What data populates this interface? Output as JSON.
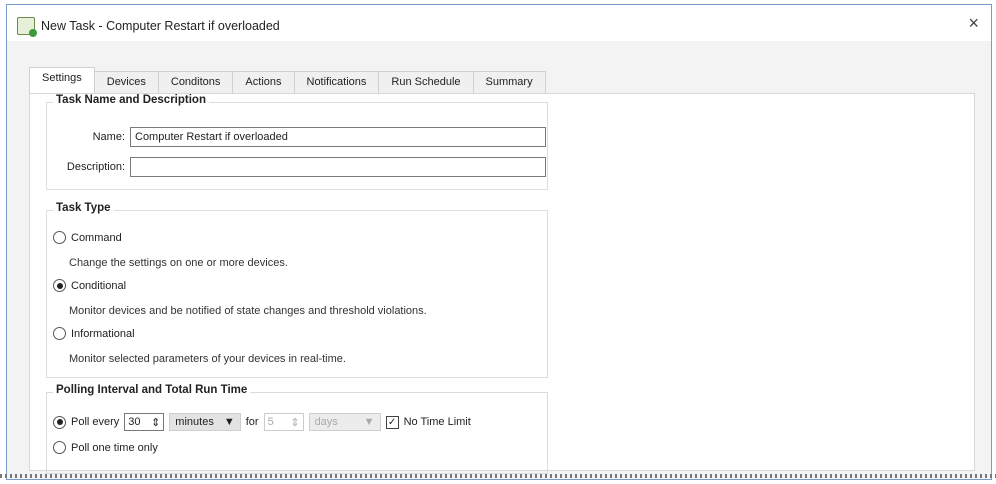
{
  "window": {
    "title": "New Task - Computer Restart if overloaded",
    "close": "×"
  },
  "tabs": [
    "Settings",
    "Devices",
    "Conditons",
    "Actions",
    "Notifications",
    "Run Schedule",
    "Summary"
  ],
  "task_name": {
    "heading": "Task Name and Description",
    "name_label": "Name:",
    "name_value": "Computer Restart if overloaded",
    "description_label": "Description:",
    "description_value": ""
  },
  "task_type": {
    "heading": "Task Type",
    "options": [
      {
        "label": "Command",
        "desc": "Change the settings on one or more devices.",
        "selected": false
      },
      {
        "label": "Conditional",
        "desc": "Monitor devices and be notified of state changes and threshold violations.",
        "selected": true
      },
      {
        "label": "Informational",
        "desc": "Monitor selected parameters of your devices in real-time.",
        "selected": false
      }
    ]
  },
  "polling": {
    "heading": "Polling Interval and Total Run Time",
    "poll_every_label": "Poll every",
    "interval": "30",
    "interval_unit": "minutes",
    "for_label": "for",
    "duration": "5",
    "duration_unit": "days",
    "no_time_limit_label": "No Time Limit",
    "no_time_limit": true,
    "poll_once_label": "Poll one time only"
  }
}
